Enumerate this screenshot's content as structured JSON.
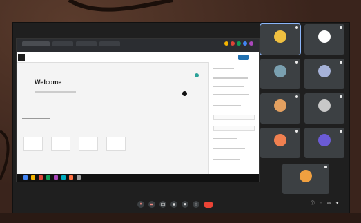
{
  "shared_screen": {
    "welcome": "Welcome"
  },
  "participants": [
    {
      "name": "",
      "avatar_color": "#f0c040",
      "active": true
    },
    {
      "name": "",
      "avatar_color": "#ffffff",
      "active": false
    },
    {
      "name": "",
      "avatar_color": "#7aa0b0",
      "active": false
    },
    {
      "name": "",
      "avatar_color": "#a6b2d8",
      "active": false
    },
    {
      "name": "",
      "avatar_color": "#e3a060",
      "active": false
    },
    {
      "name": "",
      "avatar_color": "#c8c8c8",
      "active": false
    },
    {
      "name": "",
      "avatar_color": "#f08050",
      "active": false
    },
    {
      "name": "",
      "avatar_color": "#6b5bd6",
      "active": false
    },
    {
      "name": "",
      "avatar_color": "#f0a040",
      "active": false
    }
  ],
  "controls": {
    "time": ""
  },
  "colors": {
    "accent": "#8ab4f8",
    "end_call": "#ea4335",
    "wp_blue": "#2271b1"
  }
}
